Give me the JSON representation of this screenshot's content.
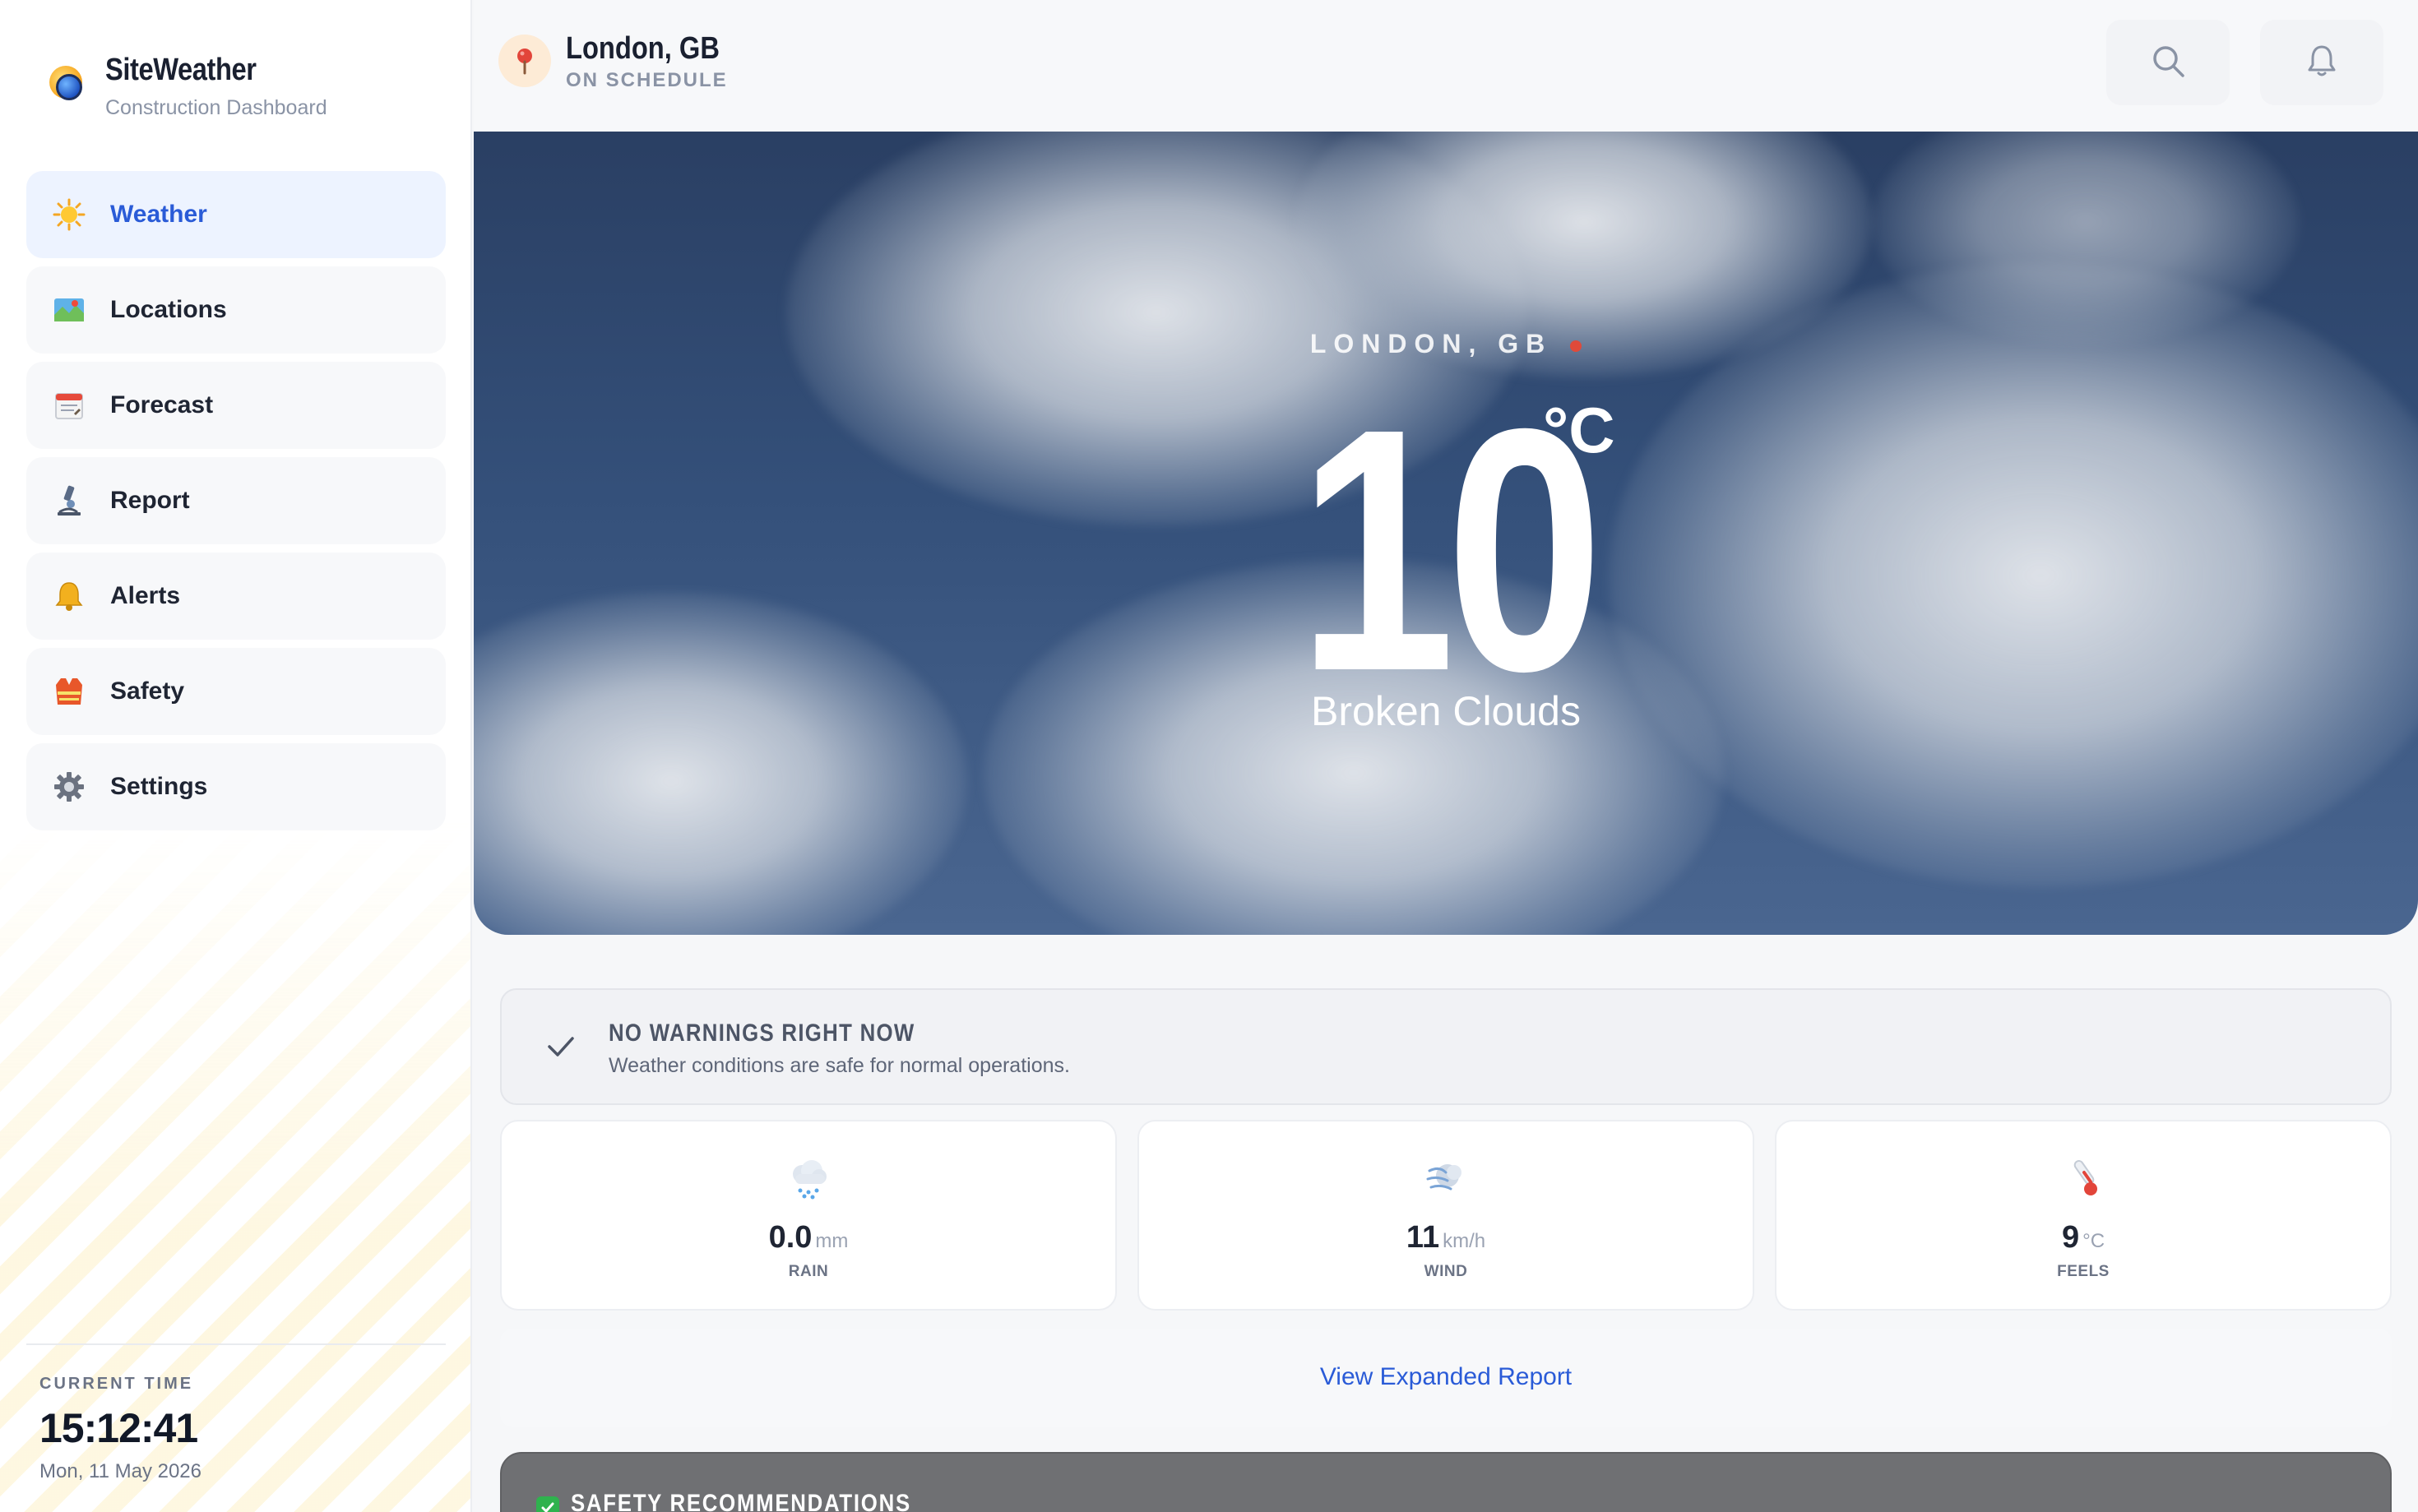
{
  "brand": {
    "title": "SiteWeather",
    "subtitle": "Construction Dashboard"
  },
  "nav": {
    "items": [
      {
        "label": "Weather",
        "icon": "sun-icon",
        "active": true
      },
      {
        "label": "Locations",
        "icon": "map-icon",
        "active": false
      },
      {
        "label": "Forecast",
        "icon": "calendar-icon",
        "active": false
      },
      {
        "label": "Report",
        "icon": "microscope-icon",
        "active": false
      },
      {
        "label": "Alerts",
        "icon": "bell-icon",
        "active": false
      },
      {
        "label": "Safety",
        "icon": "safety-vest-icon",
        "active": false
      },
      {
        "label": "Settings",
        "icon": "gear-icon",
        "active": false
      }
    ]
  },
  "clock": {
    "caption": "CURRENT TIME",
    "time": "15:12:41",
    "date": "Mon, 11 May 2026"
  },
  "header": {
    "location": "London, GB",
    "status": "ON SCHEDULE",
    "icons": [
      "pin-icon",
      "search-icon",
      "bell-icon"
    ]
  },
  "hero": {
    "location": "LONDON, GB",
    "temperature": "10",
    "unit": "°C",
    "condition": "Broken Clouds"
  },
  "warning": {
    "title": "NO WARNINGS RIGHT NOW",
    "message": "Weather conditions are safe for normal operations."
  },
  "metrics": [
    {
      "icon": "rain-cloud-icon",
      "value": "0.0",
      "unit": "mm",
      "label": "RAIN"
    },
    {
      "icon": "wind-icon",
      "value": "11",
      "unit": "km/h",
      "label": "WIND"
    },
    {
      "icon": "thermometer-icon",
      "value": "9",
      "unit": "°C",
      "label": "FEELS"
    }
  ],
  "report": {
    "link_label": "View Expanded Report"
  },
  "safety": {
    "title": "SAFETY RECOMMENDATIONS"
  },
  "colors": {
    "accent": "#2a5bd7",
    "active_nav_bg": "#edf3ff",
    "safety_header": "#6f7073",
    "safety_check": "#2fb24e"
  }
}
